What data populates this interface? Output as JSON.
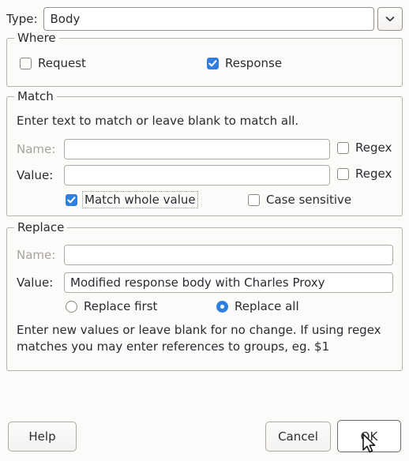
{
  "type_row": {
    "label": "Type:",
    "value": "Body",
    "dropdown_icon": "chevron-down-icon"
  },
  "where": {
    "legend": "Where",
    "request": {
      "label": "Request",
      "checked": false
    },
    "response": {
      "label": "Response",
      "checked": true
    }
  },
  "match": {
    "legend": "Match",
    "hint": "Enter text to match or leave blank to match all.",
    "name_label": "Name:",
    "name_value": "",
    "name_placeholder": "",
    "name_disabled": true,
    "name_regex": {
      "label": "Regex",
      "checked": false
    },
    "value_label": "Value:",
    "value_value": "",
    "value_placeholder": "",
    "value_regex": {
      "label": "Regex",
      "checked": false
    },
    "match_whole_value": {
      "label": "Match whole value",
      "checked": true,
      "focused": true
    },
    "case_sensitive": {
      "label": "Case sensitive",
      "checked": false
    }
  },
  "replace": {
    "legend": "Replace",
    "name_label": "Name:",
    "name_value": "",
    "name_placeholder": "",
    "name_disabled": true,
    "value_label": "Value:",
    "value_value": "Modified response body with Charles Proxy",
    "replace_first": {
      "label": "Replace first",
      "selected": false
    },
    "replace_all": {
      "label": "Replace all",
      "selected": true
    },
    "hint_line1": "Enter new values or leave blank for no change. If using regex",
    "hint_line2": "matches you may enter references to groups, eg. $1"
  },
  "buttons": {
    "help": "Help",
    "cancel": "Cancel",
    "ok": "OK"
  },
  "colors": {
    "accent": "#2f7fe0",
    "window_bg": "#fbfbfa",
    "text": "#2b2b33",
    "disabled_text": "#a8a39d",
    "field_border": "#b1aaa3",
    "group_border": "#b9b2ab"
  },
  "cursor": {
    "icon": "mouse-pointer-icon"
  }
}
